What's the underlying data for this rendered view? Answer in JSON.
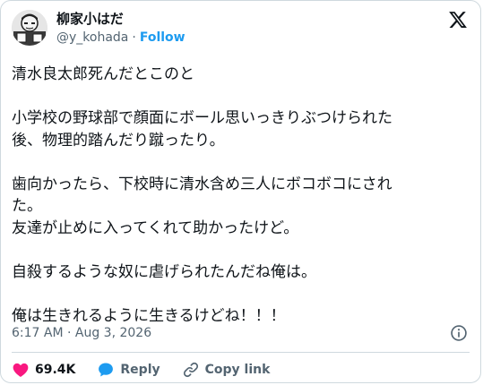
{
  "author": {
    "display_name": "柳家小はだ",
    "handle": "@y_kohada",
    "separator": "·",
    "follow_label": "Follow"
  },
  "tweet": {
    "paragraphs": [
      [
        "清水良太郎死んだとこのと"
      ],
      [
        "小学校の野球部で顔面にボール思いっきりぶつけられた",
        "後、物理的踏んだり蹴ったり。"
      ],
      [
        "歯向かったら、下校時に清水含め三人にボコボコにされ",
        "た。",
        "友達が止めに入ってくれて助かったけど。"
      ],
      [
        "自殺するような奴に虐げられたんだね俺は。"
      ],
      [
        "俺は生きれるように生きるけどね！！！"
      ]
    ],
    "timestamp": "6:17 AM · Aug 3, 2026"
  },
  "actions": {
    "likes": "69.4K",
    "reply_label": "Reply",
    "copy_link_label": "Copy link"
  },
  "colors": {
    "like": "#f91880",
    "reply": "#1d9bf0",
    "follow": "#1d9bf0",
    "muted": "#536471"
  },
  "icons": {
    "logo": "x-logo-icon",
    "info": "info-icon",
    "like": "heart-icon",
    "reply": "speech-bubble-icon",
    "copy_link": "link-icon"
  }
}
